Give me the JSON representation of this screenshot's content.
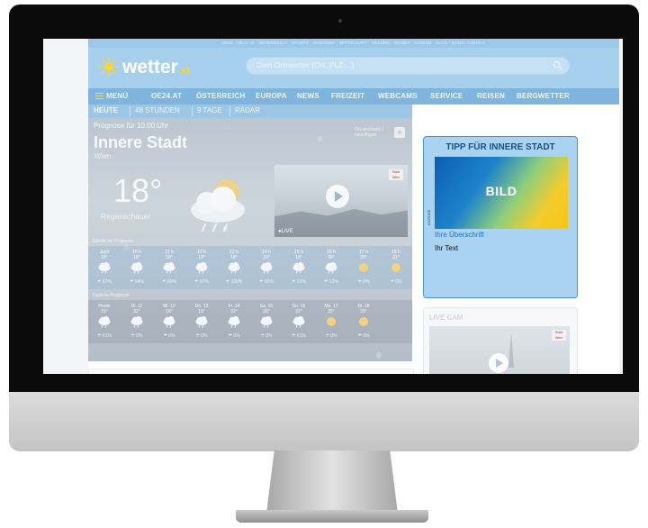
{
  "topbar": {
    "links": "OE24 · OE24.AT · ÖSTERREICH · SPORTS · MADONNA · WIRTSCHAFT · GESUND · REISEN · GAMING · AUTO · RADIO AUSTRIA"
  },
  "header": {
    "logo_text": "wetter",
    "logo_suffix": ".at",
    "search_placeholder": "Dein Ortswetter (Ort, PLZ ...)"
  },
  "nav": {
    "items": [
      "MENÜ",
      "OE24.AT",
      "ÖSTERREICH",
      "EUROPA",
      "NEWS",
      "FREIZEIT",
      "WEBCAMS",
      "SERVICE",
      "REISEN",
      "BERGWETTER"
    ]
  },
  "subnav": {
    "tabs": [
      "HEUTE",
      "48 STUNDEN",
      "9 TAGE",
      "RADAR"
    ]
  },
  "weather": {
    "forecast_label": "Prognose für 10:00 Uhr",
    "city": "Innere Stadt",
    "country": "Wien",
    "temperature": "18°",
    "condition": "Regenschauer",
    "change_location": "Ort wechseln / hinzufügen",
    "live_label": "●LIVE",
    "cam_logo": "Stadt Wien",
    "hourly_title": "Stündliche Prognose",
    "hourly": [
      {
        "time": "Jetzt",
        "temp": "18°",
        "rain": "67%"
      },
      {
        "time": "10 h",
        "temp": "18°",
        "rain": "64%"
      },
      {
        "time": "11 h",
        "temp": "18°",
        "rain": "60%"
      },
      {
        "time": "12 h",
        "temp": "18°",
        "rain": "67%"
      },
      {
        "time": "13 h",
        "temp": "18°",
        "rain": "100%"
      },
      {
        "time": "14 h",
        "temp": "19°",
        "rain": "60%"
      },
      {
        "time": "15 h",
        "temp": "19°",
        "rain": "22%"
      },
      {
        "time": "16 h",
        "temp": "20°",
        "rain": "12%"
      },
      {
        "time": "17 h",
        "temp": "20°",
        "rain": "0%"
      },
      {
        "time": "18 h",
        "temp": "21°",
        "rain": "0%"
      }
    ],
    "daily_title": "Tägliche Prognose",
    "daily": [
      {
        "day": "Heute",
        "temp": "21°",
        "rain": "61%"
      },
      {
        "day": "Di. 11",
        "temp": "22°",
        "rain": "0%"
      },
      {
        "day": "Mi. 12",
        "temp": "16°",
        "rain": "0%"
      },
      {
        "day": "Do. 13",
        "temp": "19°",
        "rain": "0%"
      },
      {
        "day": "Fr. 14",
        "temp": "22°",
        "rain": "0%"
      },
      {
        "day": "Sa. 15",
        "temp": "26°",
        "rain": "0%"
      },
      {
        "day": "So. 16",
        "temp": "22°",
        "rain": "61%"
      },
      {
        "day": "Mo. 17",
        "temp": "25°",
        "rain": "0%"
      },
      {
        "day": "Di. 18",
        "temp": "29°",
        "rain": "0%"
      }
    ]
  },
  "sidebar": {
    "tip_title": "TIPP FÜR INNERE STADT",
    "ad_image_text": "BILD",
    "ad_tag": "ANZEIGE",
    "ad_headline": "Ihre Überschrift",
    "ad_body": "Ihr Text",
    "livecam_title": "LIVE CAM",
    "livecam_logo": "Stadt Wien"
  },
  "colors": {
    "brand_blue": "#7fb5dd",
    "header_blue": "#a7d0ee",
    "tip_blue": "#1c4f86",
    "link_blue": "#1b73c2",
    "sun_yellow": "#f9d43a"
  }
}
